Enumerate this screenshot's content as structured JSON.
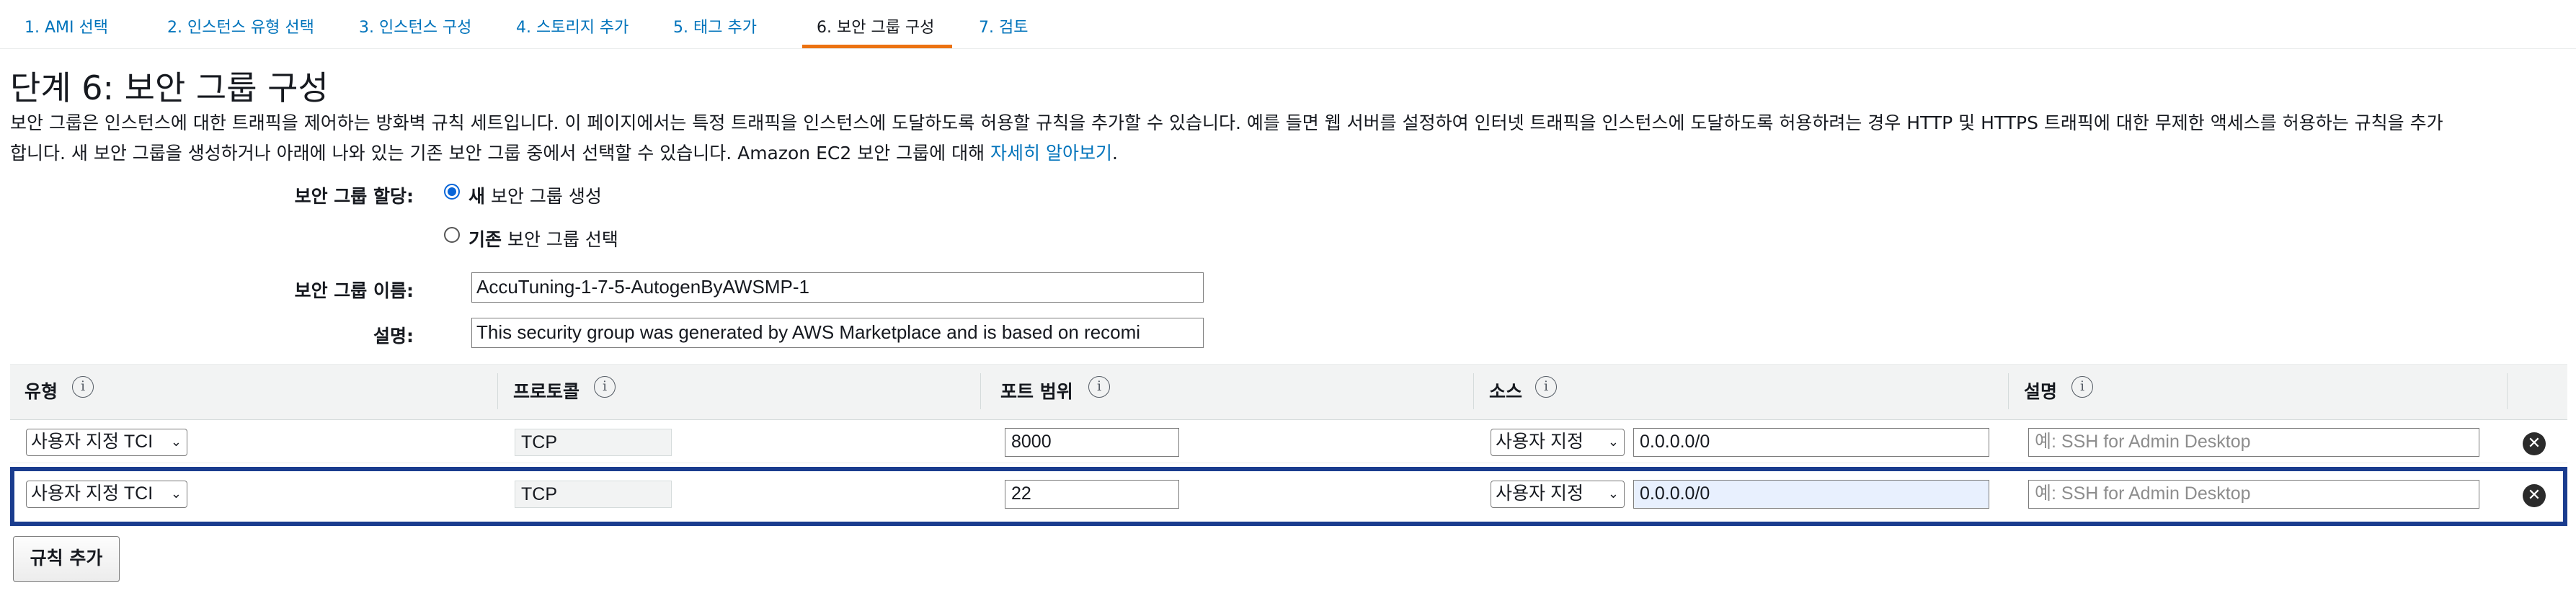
{
  "steps": [
    {
      "label": "1. AMI 선택"
    },
    {
      "label": "2. 인스턴스 유형 선택"
    },
    {
      "label": "3. 인스턴스 구성"
    },
    {
      "label": "4. 스토리지 추가"
    },
    {
      "label": "5. 태그 추가"
    },
    {
      "label": "6. 보안 그룹 구성",
      "active": true
    },
    {
      "label": "7. 검토"
    }
  ],
  "page": {
    "title": "단계 6: 보안 그룹 구성",
    "description_line1": "보안 그룹은 인스턴스에 대한 트래픽을 제어하는 방화벽 규칙 세트입니다. 이 페이지에서는 특정 트래픽을 인스턴스에 도달하도록 허용할 규칙을 추가할 수 있습니다. 예를 들면 웹 서버를 설정하여 인터넷 트래픽을 인스턴스에 도달하도록 허용하려는 경우 HTTP 및 HTTPS 트래픽에 대한 무제한 액세스를 허용하는 규칙을 추가",
    "description_line2": "합니다. 새 보안 그룹을 생성하거나 아래에 나와 있는 기존 보안 그룹 중에서 선택할 수 있습니다. Amazon EC2 보안 그룹에 대해",
    "learn_more": "자세히 알아보기",
    "period": "."
  },
  "assign": {
    "label": "보안 그룹 할당:",
    "option_new_bold": "새",
    "option_new_rest": " 보안 그룹 생성",
    "option_existing_bold": "기존",
    "option_existing_rest": " 보안 그룹 선택",
    "selected": "new"
  },
  "group_name": {
    "label": "보안 그룹 이름:",
    "value": "AccuTuning-1-7-5-AutogenByAWSMP-1"
  },
  "group_desc": {
    "label": "설명:",
    "value": "This security group was generated by AWS Marketplace and is based on recomi"
  },
  "table": {
    "headers": {
      "type": "유형",
      "protocol": "프로토콜",
      "port_range": "포트 범위",
      "source": "소스",
      "description": "설명"
    },
    "info_glyph": "i",
    "rows": [
      {
        "type": "사용자 지정 TCI",
        "protocol": "TCP",
        "port": "8000",
        "source_type": "사용자 지정",
        "source_cidr": "0.0.0.0/0",
        "desc_placeholder": "예: SSH for Admin Desktop"
      },
      {
        "type": "사용자 지정 TCI",
        "protocol": "TCP",
        "port": "22",
        "source_type": "사용자 지정",
        "source_cidr": "0.0.0.0/0",
        "desc_placeholder": "예: SSH for Admin Desktop"
      }
    ]
  },
  "add_rule_label": "규칙 추가",
  "icons": {
    "caret": "chevron-down-icon",
    "remove": "close-circle-icon",
    "info": "info-icon"
  },
  "colors": {
    "link": "#0073bb",
    "active_tab_underline": "#ec7211",
    "row_highlight": "#1a3c8e",
    "radio": "#0a66d8"
  }
}
